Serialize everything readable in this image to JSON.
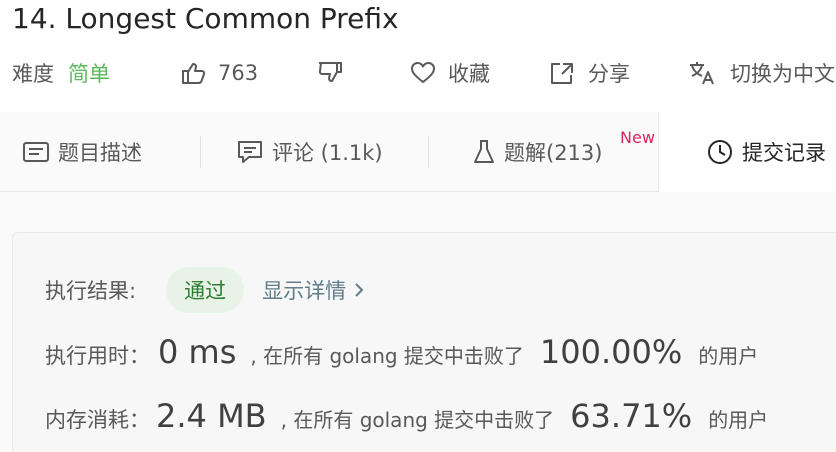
{
  "problem": {
    "title": "14. Longest Common Prefix"
  },
  "meta": {
    "difficulty_label": "难度",
    "difficulty_value": "简单",
    "likes": "763",
    "favorite_label": "收藏",
    "share_label": "分享",
    "language_toggle_label": "切换为中文"
  },
  "tabs": [
    {
      "label": "题目描述",
      "icon": "description-icon"
    },
    {
      "label": "评论 (1.1k)",
      "icon": "comment-icon"
    },
    {
      "label": "题解(213)",
      "icon": "flask-icon",
      "badge": "New"
    },
    {
      "label": "提交记录",
      "icon": "clock-icon",
      "active": true
    }
  ],
  "result": {
    "status_label": "执行结果:",
    "status_value": "通过",
    "details_link": "显示详情",
    "runtime_label": "执行用时：",
    "runtime_value": "0 ms",
    "runtime_text": ", 在所有 golang 提交中击败了",
    "runtime_percent": "100.00%",
    "runtime_suffix": "的用户",
    "memory_label": "内存消耗：",
    "memory_value": "2.4 MB",
    "memory_text": ", 在所有 golang 提交中击败了",
    "memory_percent": "63.71%",
    "memory_suffix": "的用户"
  },
  "colors": {
    "easy": "#5cb85c",
    "pass_bg": "#e8f3e8",
    "pass_text": "#2e7d32",
    "new_badge": "#e0245e"
  }
}
